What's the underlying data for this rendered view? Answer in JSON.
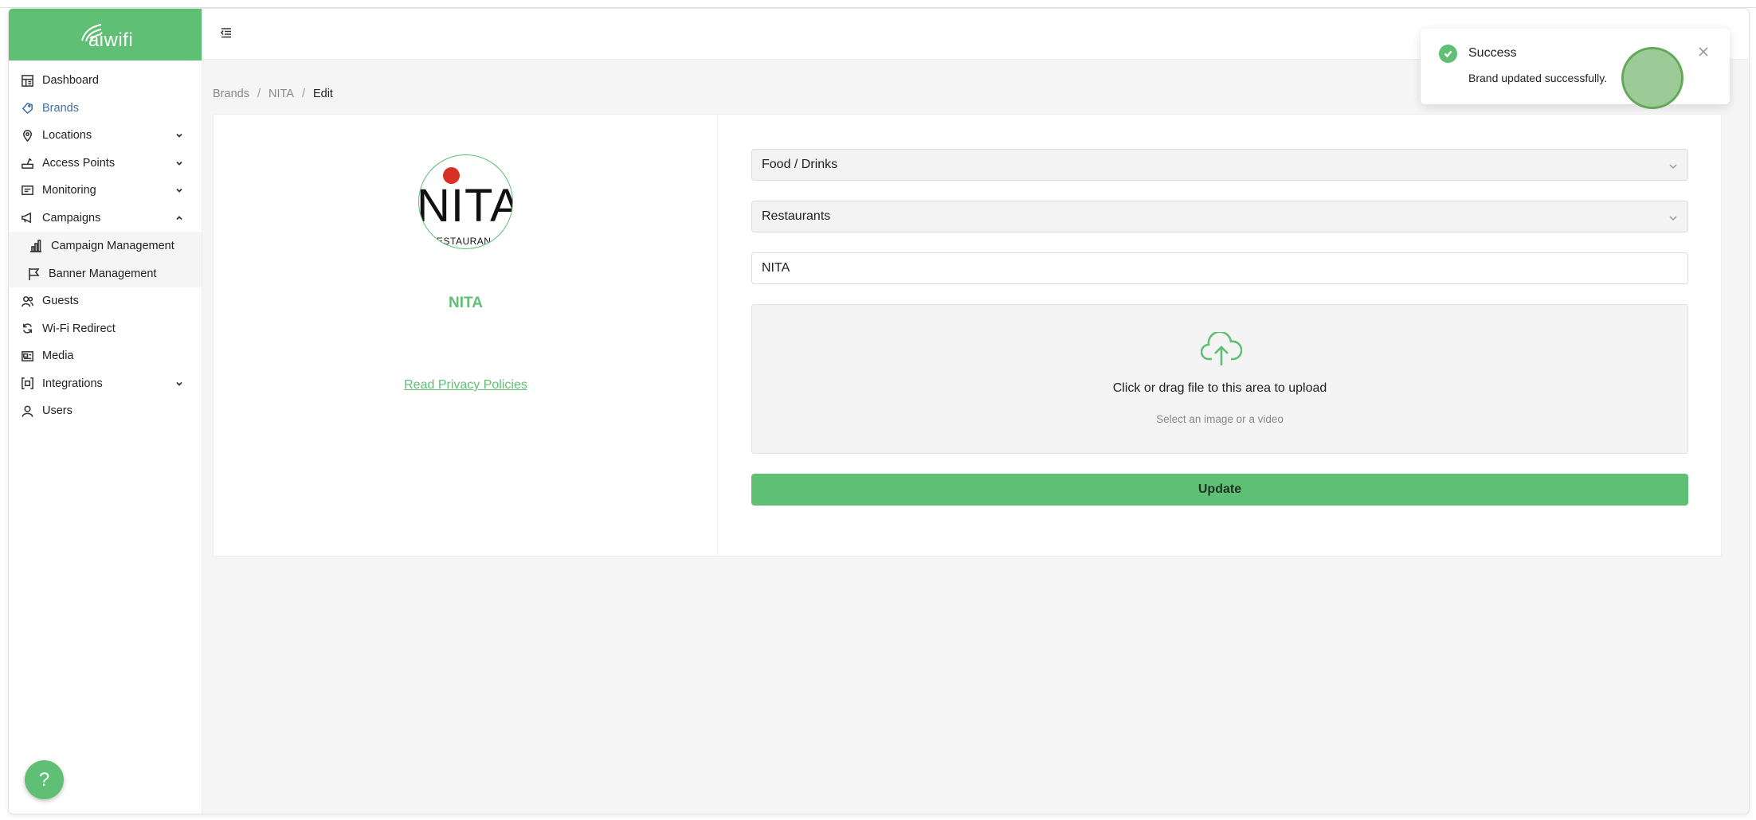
{
  "app": {
    "logo_text": "aiwifi",
    "brand_color": "#5fbf74",
    "accent_blue": "#3e6fa8"
  },
  "sidebar": {
    "items": [
      {
        "label": "Dashboard",
        "icon": "dashboard-icon"
      },
      {
        "label": "Brands",
        "icon": "brands-icon",
        "active": true
      },
      {
        "label": "Locations",
        "icon": "location-pin-icon",
        "expandable": true
      },
      {
        "label": "Access Points",
        "icon": "router-icon",
        "expandable": true
      },
      {
        "label": "Monitoring",
        "icon": "monitor-icon",
        "expandable": true
      },
      {
        "label": "Campaigns",
        "icon": "megaphone-icon",
        "expandable": true,
        "expanded": true
      }
    ],
    "campaign_sub": [
      {
        "label": "Campaign Management",
        "icon": "bar-chart-icon"
      },
      {
        "label": "Banner Management",
        "icon": "flag-icon"
      }
    ],
    "items_after": [
      {
        "label": "Guests",
        "icon": "users-icon"
      },
      {
        "label": "Wi-Fi Redirect",
        "icon": "refresh-icon"
      },
      {
        "label": "Media",
        "icon": "media-icon"
      },
      {
        "label": "Integrations",
        "icon": "integrations-icon",
        "expandable": true
      },
      {
        "label": "Users",
        "icon": "user-icon"
      }
    ],
    "help_label": "?"
  },
  "breadcrumb": {
    "items": [
      "Brands",
      "NITA",
      "Edit"
    ],
    "separator": "/"
  },
  "brand": {
    "name": "NITA",
    "logo_big_text": "NITA",
    "logo_small_text": "ESTAURAN",
    "privacy_link": "Read Privacy Policies"
  },
  "form": {
    "category": "Food / Drinks",
    "subcategory": "Restaurants",
    "brand_name_value": "NITA",
    "upload_main": "Click or drag file to this area to upload",
    "upload_hint": "Select an image or a video",
    "update_label": "Update"
  },
  "toast": {
    "title": "Success",
    "message": "Brand updated successfully."
  }
}
